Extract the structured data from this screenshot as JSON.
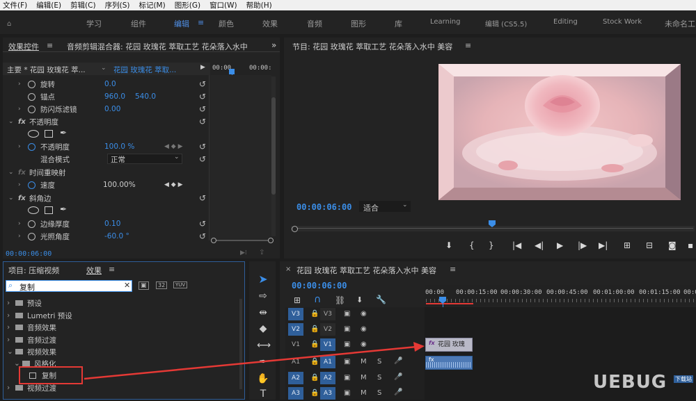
{
  "menu": [
    "文件(F)",
    "编辑(E)",
    "剪辑(C)",
    "序列(S)",
    "标记(M)",
    "图形(G)",
    "窗口(W)",
    "帮助(H)"
  ],
  "workspaces": [
    "学习",
    "组件",
    "编辑",
    "颜色",
    "效果",
    "音频",
    "图形",
    "库",
    "Learning",
    "编辑 (CS5.5)",
    "Editing",
    "Stock Work",
    "未命名工"
  ],
  "effect_controls": {
    "tab": "效果控件",
    "tab2": "音频剪辑混合器: 花园 玫瑰花 萃取工艺 花朵落入水中",
    "master": "主要 * 花园 玫瑰花 萃...",
    "clip": "花园 玫瑰花 萃取...",
    "tc1": "00:00",
    "tc2": "00:00:",
    "rotate": "旋转",
    "rotate_val": "0.0",
    "anchor": "锚点",
    "anchor_x": "960.0",
    "anchor_y": "540.0",
    "flicker": "防闪烁滤镜",
    "flicker_val": "0.00",
    "opacity_section": "不透明度",
    "opacity": "不透明度",
    "opacity_val": "100.0 %",
    "blend": "混合模式",
    "blend_val": "正常",
    "remap": "时间重映射",
    "speed": "速度",
    "speed_val": "100.00%",
    "bevel": "斜角边",
    "edge": "边缘厚度",
    "edge_val": "0.10",
    "light": "光照角度",
    "light_val": "-60.0 °",
    "timecode": "00:00:06:00"
  },
  "program": {
    "title": "节目: 花园 玫瑰花 萃取工艺 花朵落入水中 美容",
    "timecode": "00:00:06:00",
    "fit": "适合"
  },
  "project": {
    "tab1": "项目: 压缩视频",
    "tab2": "效果",
    "search": "复制",
    "items": [
      "预设",
      "Lumetri 预设",
      "音频效果",
      "音频过渡",
      "视频效果",
      "风格化",
      "复制",
      "视频过渡"
    ]
  },
  "timeline": {
    "title": "花园 玫瑰花 萃取工艺 花朵落入水中 美容",
    "timecode": "00:00:06:00",
    "ruler": [
      "00:00",
      "00:00:15:00",
      "00:00:30:00",
      "00:00:45:00",
      "00:01:00:00",
      "00:01:15:00",
      "00:0"
    ],
    "tracks": [
      {
        "src": "V3",
        "dst": "V3"
      },
      {
        "src": "V2",
        "dst": "V2"
      },
      {
        "src": "V1",
        "dst": "V1"
      },
      {
        "src": "A1",
        "dst": "A1"
      },
      {
        "src": "A2",
        "dst": "A2"
      },
      {
        "src": "A3",
        "dst": "A3"
      }
    ],
    "clip_label": "花园 玫瑰",
    "m": "M",
    "s": "S"
  },
  "watermark": "UEBUG",
  "watermark_sub": "下载站",
  "colors": {
    "accent": "#3b8ee8",
    "annotation": "#e53935"
  }
}
